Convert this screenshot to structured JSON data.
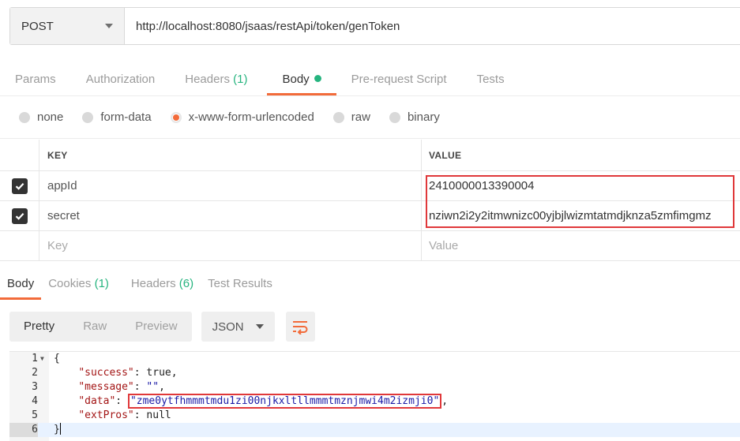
{
  "request": {
    "method": "POST",
    "url": "http://localhost:8080/jsaas/restApi/token/genToken"
  },
  "request_tabs": [
    {
      "label": "Params",
      "count": ""
    },
    {
      "label": "Authorization",
      "count": ""
    },
    {
      "label": "Headers",
      "count": "(1)"
    },
    {
      "label": "Body",
      "count": ""
    },
    {
      "label": "Pre-request Script",
      "count": ""
    },
    {
      "label": "Tests",
      "count": ""
    }
  ],
  "body_types": [
    "none",
    "form-data",
    "x-www-form-urlencoded",
    "raw",
    "binary"
  ],
  "kv_table": {
    "key_header": "KEY",
    "value_header": "VALUE",
    "rows": [
      {
        "key": "appId",
        "value": "2410000013390004"
      },
      {
        "key": "secret",
        "value": "nziwn2i2y2itmwnizc00yjbjlwizmtatmdjknza5zmfimgmz"
      }
    ],
    "key_placeholder": "Key",
    "value_placeholder": "Value"
  },
  "response_tabs": [
    {
      "label": "Body",
      "count": ""
    },
    {
      "label": "Cookies",
      "count": "(1)"
    },
    {
      "label": "Headers",
      "count": "(6)"
    },
    {
      "label": "Test Results",
      "count": ""
    }
  ],
  "view_modes": [
    "Pretty",
    "Raw",
    "Preview"
  ],
  "format": "JSON",
  "code": {
    "line_numbers": [
      "1",
      "2",
      "3",
      "4",
      "5",
      "6"
    ],
    "open_brace": "{",
    "close_brace": "}",
    "success_key": "\"success\"",
    "success_value": "true",
    "message_key": "\"message\"",
    "message_value": "\"\"",
    "data_key": "\"data\"",
    "data_value": "\"zme0ytfhmmmtmdu1zi00njkxltllmmmtmznjmwi4m2izmji0\"",
    "extpros_key": "\"extPros\"",
    "extpros_value": "null"
  },
  "colors": {
    "accent": "#f26b3a",
    "count_green": "#26b47f",
    "highlight_red": "#e0383a"
  }
}
